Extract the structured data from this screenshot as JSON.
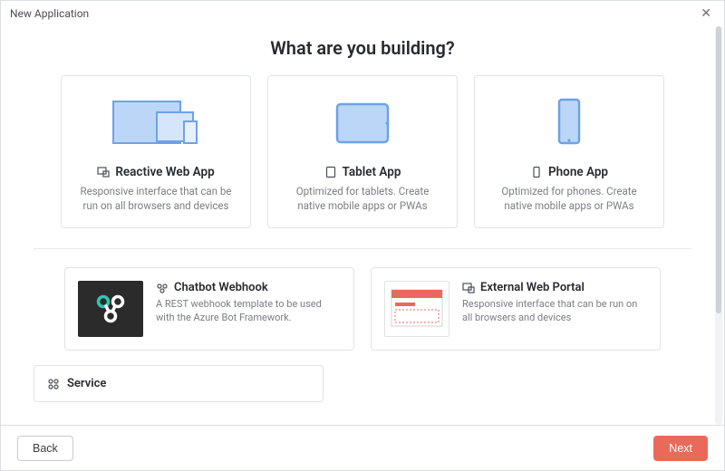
{
  "window": {
    "title": "New Application",
    "close_label": "✕"
  },
  "heading": "What are you building?",
  "cards_top": [
    {
      "title": "Reactive Web App",
      "desc": "Responsive interface that can be run on all browsers and devices"
    },
    {
      "title": "Tablet App",
      "desc": "Optimized for tablets. Create native mobile apps or PWAs"
    },
    {
      "title": "Phone App",
      "desc": "Optimized for phones. Create native mobile apps or PWAs"
    }
  ],
  "cards_wide": [
    {
      "title": "Chatbot Webhook",
      "desc": "A REST webhook template to be used with the Azure Bot Framework."
    },
    {
      "title": "External Web Portal",
      "desc": "Responsive interface that can be run on all browsers and devices"
    }
  ],
  "cards_bottom": [
    {
      "title": "Service"
    }
  ],
  "footer": {
    "back_label": "Back",
    "next_label": "Next"
  }
}
